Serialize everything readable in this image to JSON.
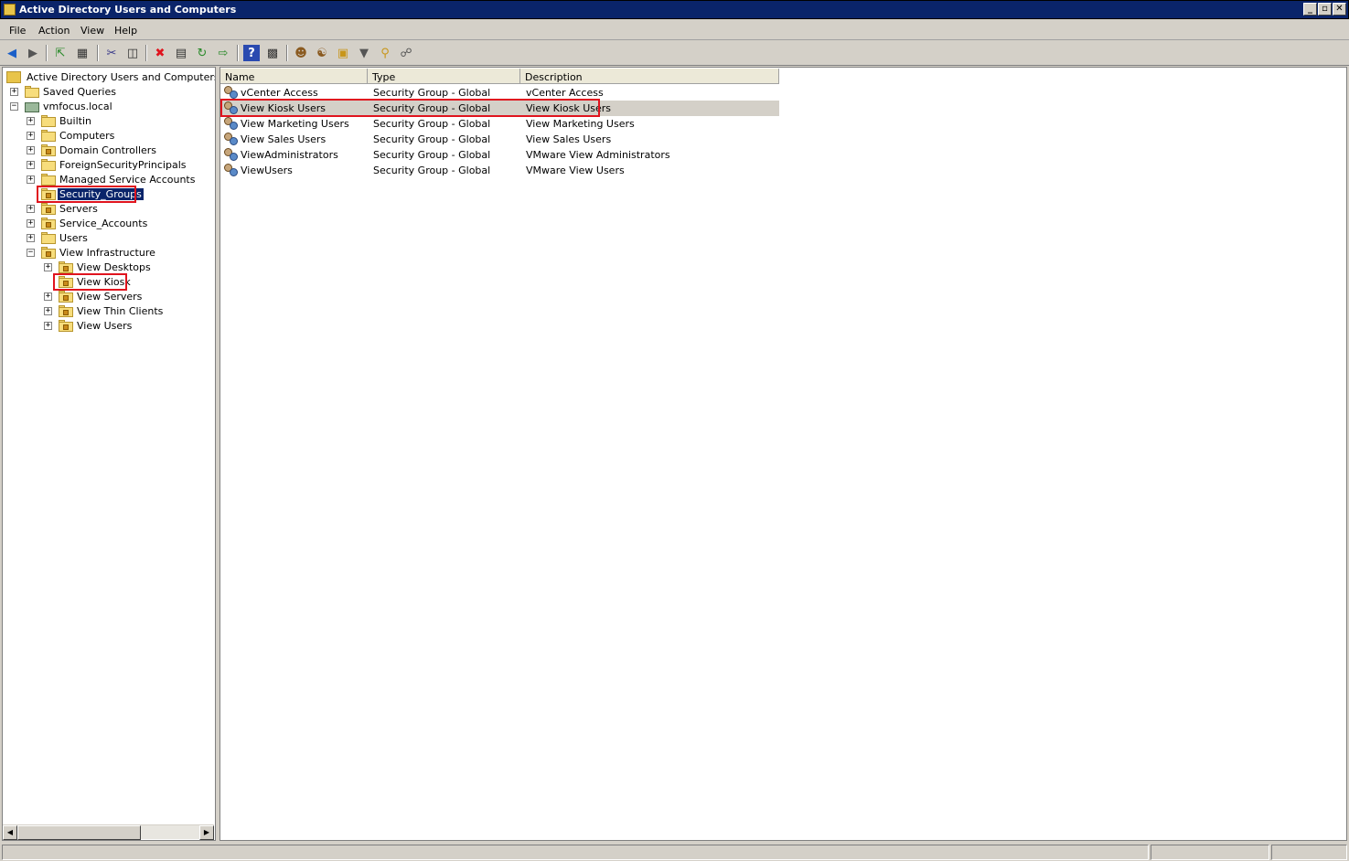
{
  "window": {
    "title": "Active Directory Users and Computers",
    "buttons": [
      "_",
      "▫",
      "✕"
    ]
  },
  "menu": [
    "File",
    "Action",
    "View",
    "Help"
  ],
  "toolbar": {
    "icons": [
      "back-arrow-icon",
      "forward-arrow-icon",
      "up-folder-icon",
      "show-hide-tree-icon",
      "cut-icon",
      "copy-icon",
      "delete-icon",
      "properties-icon",
      "refresh-icon",
      "export-list-icon",
      "help-icon",
      "console-tree-icon",
      "new-user-icon",
      "new-group-icon",
      "new-ou-icon",
      "filter-icon",
      "find-icon",
      "add-to-group-icon"
    ]
  },
  "tree": {
    "root": "Active Directory Users and Computers [VMF",
    "saved_queries": "Saved Queries",
    "domain": "vmfocus.local",
    "items": [
      {
        "label": "Builtin"
      },
      {
        "label": "Computers"
      },
      {
        "label": "Domain Controllers"
      },
      {
        "label": "ForeignSecurityPrincipals"
      },
      {
        "label": "Managed Service Accounts"
      },
      {
        "label": "Security_Groups"
      },
      {
        "label": "Servers"
      },
      {
        "label": "Service_Accounts"
      },
      {
        "label": "Users"
      },
      {
        "label": "View Infrastructure"
      }
    ],
    "sub_items": [
      {
        "label": "View Desktops"
      },
      {
        "label": "View Kiosk"
      },
      {
        "label": "View Servers"
      },
      {
        "label": "View Thin Clients"
      },
      {
        "label": "View Users"
      }
    ]
  },
  "list": {
    "columns": [
      "Name",
      "Type",
      "Description"
    ],
    "rows": [
      {
        "name": "vCenter Access",
        "type": "Security Group - Global",
        "description": "vCenter Access"
      },
      {
        "name": "View Kiosk Users",
        "type": "Security Group - Global",
        "description": "View Kiosk Users"
      },
      {
        "name": "View Marketing Users",
        "type": "Security Group - Global",
        "description": "View Marketing Users"
      },
      {
        "name": "View Sales Users",
        "type": "Security Group - Global",
        "description": "View Sales Users"
      },
      {
        "name": "ViewAdministrators",
        "type": "Security Group - Global",
        "description": "VMware View Administrators"
      },
      {
        "name": "ViewUsers",
        "type": "Security Group - Global",
        "description": "VMware View Users"
      }
    ]
  },
  "colors": {
    "titlebar": "#0a246a",
    "highlight_border": "#e0141e",
    "selection": "#0a246a"
  }
}
